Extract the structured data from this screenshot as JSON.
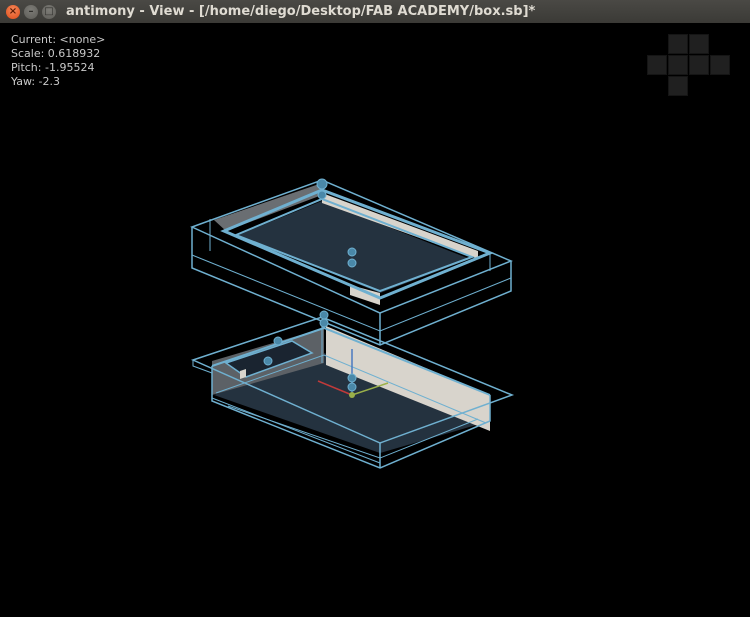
{
  "window": {
    "title": "antimony - View - [/home/diego/Desktop/FAB ACADEMY/box.sb]*",
    "close_glyph": "×",
    "minimize_glyph": "–",
    "maximize_glyph": "□"
  },
  "hud": {
    "current": "Current: <none>",
    "scale": "Scale: 0.618932",
    "pitch": "Pitch: -1.95524",
    "yaw": "Yaw: -2.3"
  },
  "colors": {
    "wire": "#6fb0d0",
    "handle": "#4a88a8",
    "face_dark": "#24323f",
    "face_light": "#d8d4cc",
    "axis_x": "#c03a3a",
    "axis_y": "#9ab04a",
    "axis_z": "#4a7ac0"
  },
  "icons": {
    "close": "close-icon",
    "minimize": "minimize-icon",
    "maximize": "maximize-icon",
    "view_cube": "view-cube-icon"
  }
}
